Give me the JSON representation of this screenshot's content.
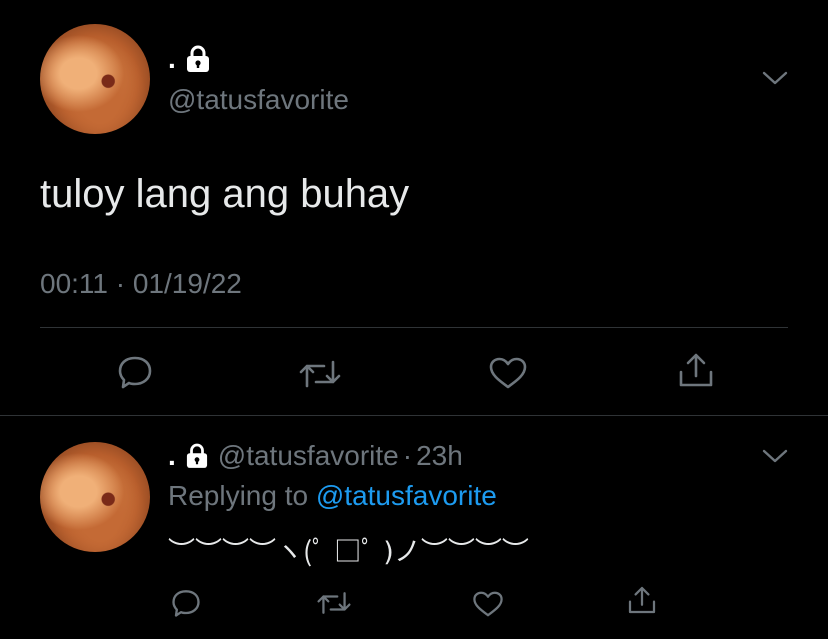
{
  "main_tweet": {
    "display_name": ".",
    "handle": "@tatusfavorite",
    "text": "tuloy lang ang buhay",
    "timestamp": "00:11 · 01/19/22"
  },
  "reply_tweet": {
    "display_name": ".",
    "handle": "@tatusfavorite",
    "separator": "·",
    "age": "23h",
    "replying_prefix": "Replying to ",
    "replying_to": "@tatusfavorite",
    "text": "︶︶︶︶ヽ(ﾟ □ﾟ )ノ︶︶︶︶"
  },
  "icons": {
    "lock": "lock-icon",
    "menu": "chevron-down-icon",
    "reply": "reply-icon",
    "retweet": "retweet-icon",
    "like": "heart-icon",
    "share": "share-icon"
  },
  "colors": {
    "background": "#000000",
    "text": "#d9d9d9",
    "muted": "#6e767d",
    "link": "#1d9bf0",
    "divider": "#2f3336"
  }
}
